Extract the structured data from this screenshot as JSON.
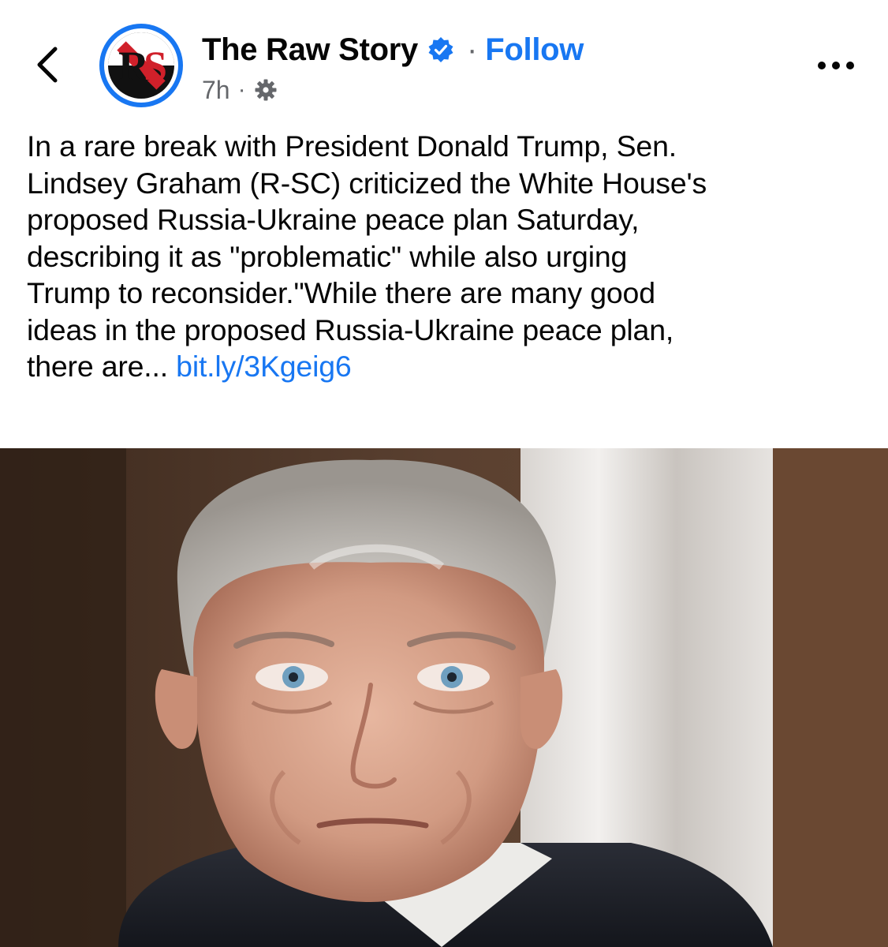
{
  "header": {
    "page_name": "The Raw Story",
    "follow_label": "Follow",
    "separator": "·",
    "timestamp": "7h",
    "avatar_letters": "RS",
    "verified_icon": "verified-badge-icon",
    "privacy_icon": "globe-gear-icon",
    "more_icon": "more-dots-icon",
    "back_icon": "chevron-left-icon"
  },
  "post": {
    "lines": [
      "In a rare break with President Donald Trump, Sen.",
      "Lindsey Graham (R-SC) criticized the White House's",
      "proposed Russia-Ukraine peace plan Saturday,",
      "describing it as \"problematic\" while also urging",
      "Trump to reconsider.\"While there are many good",
      "ideas in the proposed Russia-Ukraine peace plan,"
    ],
    "last_line_prefix": "there are...",
    "link_text": "bit.ly/3Kgeig6"
  },
  "colors": {
    "link_blue": "#1877f2",
    "secondary_gray": "#65676b",
    "text": "#050505",
    "avatar_ring": "#1877f2",
    "avatar_accent": "#d0202a"
  }
}
